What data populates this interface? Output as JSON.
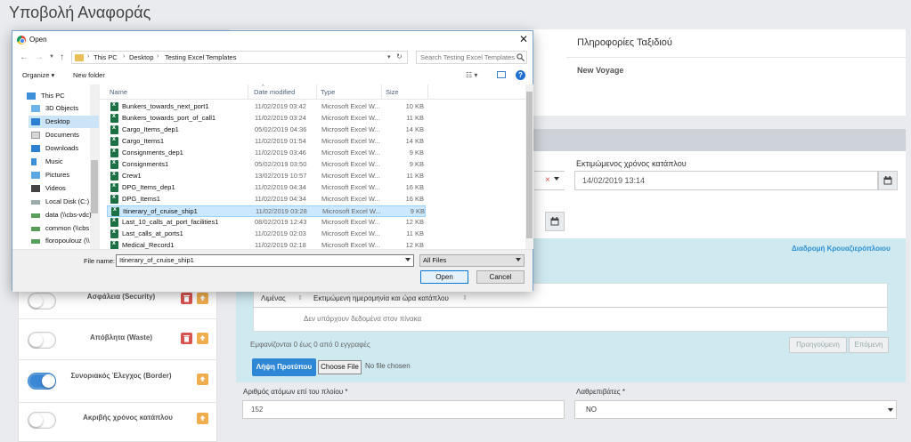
{
  "page": {
    "title": "Υποβολή Αναφοράς"
  },
  "voyage": {
    "title": "Πληροφορίες Ταξιδιού",
    "subtitle": "New Voyage"
  },
  "eta": {
    "label": "Εκτιμώμενος χρόνος κατάπλου",
    "value": "14/02/2019 13:14"
  },
  "left_select": {
    "clear_symbol": "×"
  },
  "route": {
    "title": "Διαδρομή Κρουαζιερόπλοιου",
    "columns": [
      "Λιμένας",
      "Εκτιμώμενη ημερομηνία και ώρα κατάπλου"
    ],
    "sort_symbol": "⇕",
    "empty": "Δεν υπάρχουν δεδομένα στον πίνακα",
    "info": "Εμφανίζονται 0 έως 0 από 0 εγγραφές",
    "prev": "Προηγούμενη",
    "next": "Επόμενη",
    "download": "Λήψη Προτύπου",
    "choose_file": "Choose File",
    "no_file": "No file chosen"
  },
  "persons": {
    "label": "Αριθμός ατόμων επί του πλοίου *",
    "value": "152"
  },
  "stowaways": {
    "label": "Λαθρεπιβάτες *",
    "value": "NO"
  },
  "toggles": [
    {
      "label": "Ασφάλεια (Security)",
      "on": false
    },
    {
      "label": "Απόβλητα (Waste)",
      "on": false
    },
    {
      "label": "Συνοριακός Έλεγχος (Border)",
      "on": true
    },
    {
      "label": "Ακριβής χρόνος κατάπλου",
      "on": false
    }
  ],
  "dialog": {
    "title": "Open",
    "close": "✕",
    "breadcrumb": [
      "This PC",
      "Desktop",
      "Testing Excel Templates"
    ],
    "breadcrumb_sep": "›",
    "search_placeholder": "Search Testing Excel Templates",
    "organize": "Organize ▾",
    "new_folder": "New folder",
    "help": "?",
    "nav_items": [
      {
        "label": "This PC",
        "icon": "pc-icon"
      },
      {
        "label": "3D Objects",
        "icon": "cube-icon"
      },
      {
        "label": "Desktop",
        "icon": "desktop-icon",
        "selected": true
      },
      {
        "label": "Documents",
        "icon": "documents-icon"
      },
      {
        "label": "Downloads",
        "icon": "download-icon"
      },
      {
        "label": "Music",
        "icon": "music-icon"
      },
      {
        "label": "Pictures",
        "icon": "pictures-icon"
      },
      {
        "label": "Videos",
        "icon": "videos-icon"
      },
      {
        "label": "Local Disk (C:)",
        "icon": "disk-icon"
      },
      {
        "label": "data (\\\\cbs-vdc)",
        "icon": "network-drive-icon"
      },
      {
        "label": "common (\\\\cbs",
        "icon": "network-drive-icon"
      },
      {
        "label": "floropoulouz (\\\\",
        "icon": "network-drive-icon"
      }
    ],
    "columns": {
      "name": "Name",
      "date": "Date modified",
      "type": "Type",
      "size": "Size"
    },
    "files": [
      {
        "name": "Bunkers_towards_next_port1",
        "date": "11/02/2019 03:42",
        "type": "Microsoft Excel W...",
        "size": "10 KB"
      },
      {
        "name": "Bunkers_towards_port_of_call1",
        "date": "11/02/2019 03:24",
        "type": "Microsoft Excel W...",
        "size": "11 KB"
      },
      {
        "name": "Cargo_Items_dep1",
        "date": "05/02/2019 04:36",
        "type": "Microsoft Excel W...",
        "size": "14 KB"
      },
      {
        "name": "Cargo_Items1",
        "date": "11/02/2019 01:54",
        "type": "Microsoft Excel W...",
        "size": "14 KB"
      },
      {
        "name": "Consignments_dep1",
        "date": "11/02/2019 03:46",
        "type": "Microsoft Excel W...",
        "size": "9 KB"
      },
      {
        "name": "Consignments1",
        "date": "05/02/2019 03:50",
        "type": "Microsoft Excel W...",
        "size": "9 KB"
      },
      {
        "name": "Crew1",
        "date": "13/02/2019 10:57",
        "type": "Microsoft Excel W...",
        "size": "11 KB"
      },
      {
        "name": "DPG_Items_dep1",
        "date": "11/02/2019 04:34",
        "type": "Microsoft Excel W...",
        "size": "16 KB"
      },
      {
        "name": "DPG_Items1",
        "date": "11/02/2019 04:34",
        "type": "Microsoft Excel W...",
        "size": "16 KB"
      },
      {
        "name": "Itinerary_of_cruise_ship1",
        "date": "11/02/2019 03:28",
        "type": "Microsoft Excel W...",
        "size": "9 KB",
        "selected": true
      },
      {
        "name": "Last_10_calls_at_port_facilities1",
        "date": "08/02/2019 12:43",
        "type": "Microsoft Excel W...",
        "size": "12 KB"
      },
      {
        "name": "Last_calls_at_ports1",
        "date": "11/02/2019 02:03",
        "type": "Microsoft Excel W...",
        "size": "11 KB"
      },
      {
        "name": "Medical_Record1",
        "date": "11/02/2019 02:18",
        "type": "Microsoft Excel W...",
        "size": "12 KB"
      }
    ],
    "filename_label": "File name:",
    "filename_value": "Itinerary_of_cruise_ship1",
    "filetype_value": "All Files",
    "open": "Open",
    "cancel": "Cancel"
  },
  "colors": {
    "accent": "#2e86d6",
    "route_bg": "#cfe9f1",
    "danger": "#d9534f",
    "warning": "#f0ad4e"
  }
}
